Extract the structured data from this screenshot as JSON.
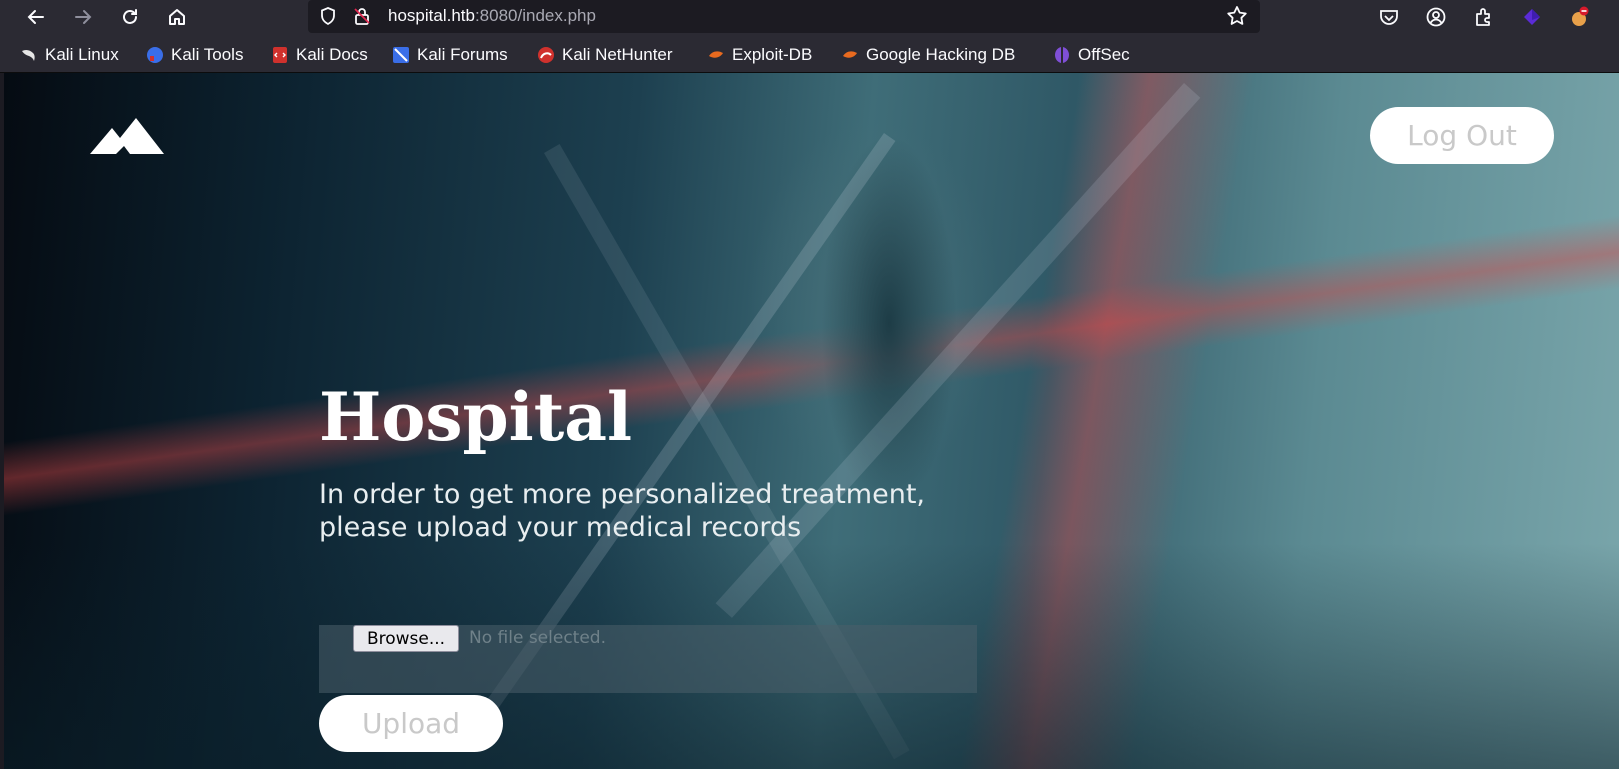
{
  "browser": {
    "url_host": "hospital.htb",
    "url_path": ":8080/index.php",
    "icons": [
      "back-arrow-icon",
      "forward-arrow-icon",
      "reload-icon",
      "home-icon",
      "shield-icon",
      "lock-icon",
      "star-icon",
      "pocket-icon",
      "account-icon",
      "extensions-icon",
      "extension-purple-icon",
      "extension-fox-icon"
    ]
  },
  "bookmarks": [
    {
      "label": "Kali Linux",
      "color": "#1a1a1a"
    },
    {
      "label": "Kali Tools",
      "color": "#3a6ee8"
    },
    {
      "label": "Kali Docs",
      "color": "#d0312d"
    },
    {
      "label": "Kali Forums",
      "color": "#3a6ee8"
    },
    {
      "label": "Kali NetHunter",
      "color": "#d0312d"
    },
    {
      "label": "Exploit-DB",
      "color": "#e86a1f"
    },
    {
      "label": "Google Hacking DB",
      "color": "#e86a1f"
    },
    {
      "label": "OffSec",
      "color": "#7f4fd6"
    }
  ],
  "page": {
    "logout_label": "Log Out",
    "title": "Hospital",
    "subtitle_line1": "In order to get more personalized treatment,",
    "subtitle_line2": "please upload your medical records",
    "browse_label": "Browse...",
    "file_status": "No file selected.",
    "upload_label": "Upload"
  }
}
